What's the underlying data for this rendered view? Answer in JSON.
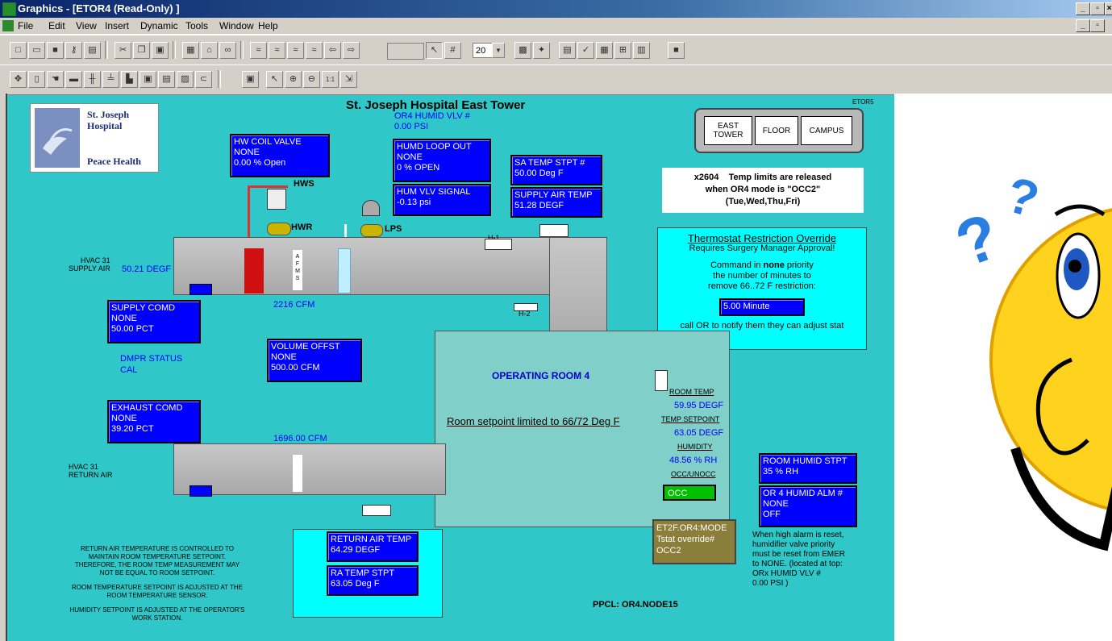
{
  "window": {
    "title": "Graphics - [ETOR4 (Read-Only) ]"
  },
  "menu": [
    "File",
    "Edit",
    "View",
    "Insert",
    "Dynamic",
    "Tools",
    "Window",
    "Help"
  ],
  "toolbar": {
    "zoom_value": "20"
  },
  "graphic": {
    "title": "St. Joseph Hospital East Tower",
    "corner_tag": "ETOR5",
    "logo": {
      "line1": "St. Joseph",
      "line2": "Hospital",
      "line3": "Peace Health"
    },
    "or4_humid_vlv": {
      "label": "OR4 HUMID VLV #",
      "value": "0.00 PSI"
    },
    "nav": {
      "east_tower": "EAST TOWER",
      "floor": "FLOOR",
      "campus": "CAMPUS"
    },
    "notice": {
      "line1": "x2604    Temp limits are released",
      "line2": "when OR4 mode is \"OCC2\"",
      "line3": "(Tue,Wed,Thu,Fri)"
    },
    "hw_coil": {
      "title": "HW COIL VALVE",
      "mode": "NONE",
      "value": "0.00 % Open"
    },
    "humd_loop": {
      "title": "HUMD LOOP OUT",
      "mode": "NONE",
      "value": "0 % OPEN"
    },
    "hum_vlv_signal": {
      "title": "HUM VLV SIGNAL",
      "value": "-0.13 psi"
    },
    "sa_temp_stpt": {
      "title": "SA TEMP STPT #",
      "value": "50.00 Deg F"
    },
    "supply_air_temp": {
      "title": "SUPPLY AIR TEMP",
      "value": "51.28 DEGF"
    },
    "hws": "HWS",
    "hwr": "HWR",
    "lps": "LPS",
    "h1": "H-1",
    "h2": "H-2",
    "afms": "AFMS",
    "hvac_supply": {
      "line1": "HVAC 31",
      "line2": "SUPPLY AIR",
      "value": "50.21 DEGF"
    },
    "supply_cfm": "2216  CFM",
    "supply_comd": {
      "title": "SUPPLY COMD",
      "mode": "NONE",
      "value": "50.00 PCT"
    },
    "dmpr": {
      "line1": "DMPR STATUS",
      "line2": "CAL"
    },
    "volume_offst": {
      "title": "VOLUME OFFST",
      "mode": "NONE",
      "value": "500.00  CFM"
    },
    "exhaust_comd": {
      "title": "EXHAUST COMD",
      "mode": "NONE",
      "value": "39.20 PCT"
    },
    "return_cfm": "1696.00  CFM",
    "hvac_return": {
      "line1": "HVAC 31",
      "line2": "RETURN AIR"
    },
    "thermostat": {
      "title": "Thermostat Restriction Override",
      "subtitle": "Requires Surgery Manager Approval!",
      "cmd1": "Command in ",
      "cmd_bold": "none",
      "cmd2": " priority",
      "line2": "the number of minutes to",
      "line3": "remove 66..72 F restriction:",
      "minutes": "5.00 Minute",
      "footer": "call OR to notify them they can adjust stat"
    },
    "room": {
      "name": "OPERATING ROOM 4",
      "setpoint_note": "Room setpoint limited to 66/72 Deg F",
      "room_temp_label": "ROOM TEMP",
      "room_temp": "59.95 DEGF",
      "temp_setpoint_label": "TEMP SETPOINT",
      "temp_setpoint": "63.05 DEGF",
      "humidity_label": "HUMIDITY",
      "humidity": "48.56 % RH",
      "occ_label": "OCC/UNOCC",
      "occ_value": "OCC"
    },
    "mode": {
      "line1": "ET2F.OR4:MODE",
      "line2": "Tstat override#",
      "line3": "OCC2"
    },
    "room_humid_stpt": {
      "title": "ROOM HUMID STPT",
      "value": "35 % RH"
    },
    "or4_humid_alm": {
      "title": "OR 4 HUMID ALM #",
      "mode": "NONE",
      "value": "OFF"
    },
    "humid_note": [
      "When high alarm is reset,",
      "humidifier valve priority",
      "must be reset from EMER",
      "to NONE. (located at top:",
      "ORx HUMID VLV #",
      "0.00 PSI )"
    ],
    "return_air_temp": {
      "title": "RETURN AIR TEMP",
      "value": "64.29 DEGF"
    },
    "ra_temp_stpt": {
      "title": "RA TEMP STPT",
      "value": "63.05 Deg F"
    },
    "notes": [
      "RETURN AIR TEMPERATURE IS CONTROLLED TO",
      "MAINTAIN ROOM TEMPERATURE SETPOINT.",
      "THEREFORE, THE ROOM TEMP MEASUREMENT MAY",
      "NOT BE EQUAL TO ROOM SETPOINT.",
      "ROOM  TEMPERATURE SETPOINT IS ADJUSTED AT THE",
      "ROOM  TEMPERATURE SENSOR.",
      "HUMIDITY SETPOINT IS ADJUSTED AT THE OPERATOR'S",
      "WORK STATION."
    ],
    "ppcl": "PPCL:  OR4.NODE15"
  },
  "icons": [
    "confused-emoji-icon",
    "question-mark-icon",
    "valve-icon",
    "fan-icon",
    "thermostat-icon"
  ],
  "colors": {
    "canvas": "#2fc7c7",
    "point_box": "#0000ff",
    "occ_green": "#00c000",
    "mode_box": "#8b7d3a"
  }
}
